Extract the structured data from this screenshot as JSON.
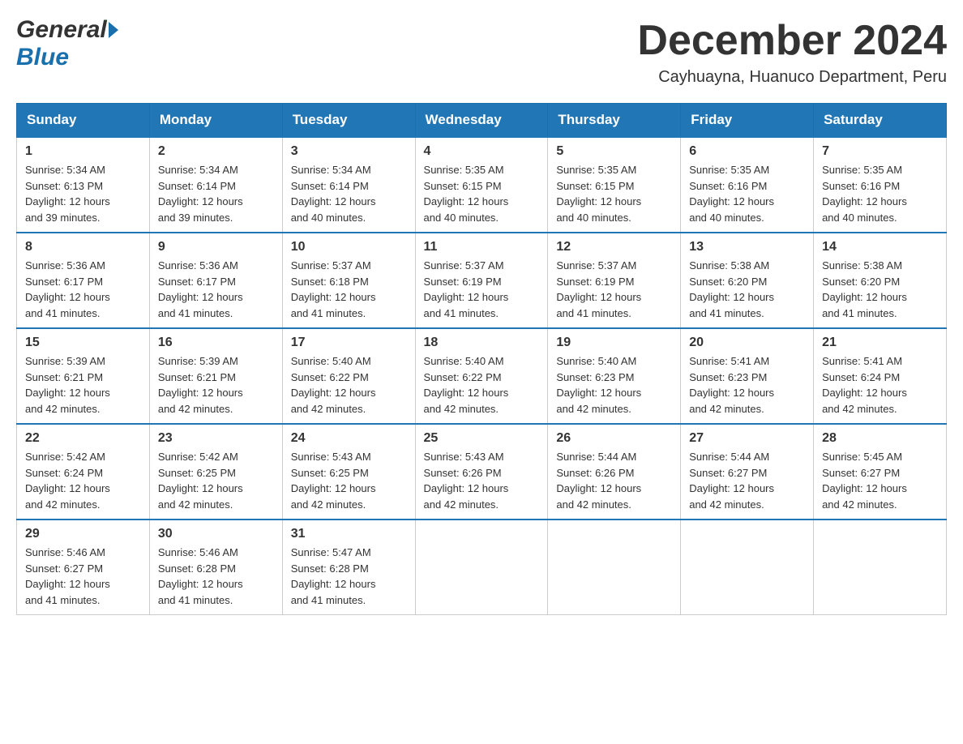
{
  "header": {
    "month_title": "December 2024",
    "location": "Cayhuayna, Huanuco Department, Peru"
  },
  "days_of_week": [
    "Sunday",
    "Monday",
    "Tuesday",
    "Wednesday",
    "Thursday",
    "Friday",
    "Saturday"
  ],
  "weeks": [
    [
      {
        "day": "1",
        "sunrise": "5:34 AM",
        "sunset": "6:13 PM",
        "daylight": "12 hours and 39 minutes."
      },
      {
        "day": "2",
        "sunrise": "5:34 AM",
        "sunset": "6:14 PM",
        "daylight": "12 hours and 39 minutes."
      },
      {
        "day": "3",
        "sunrise": "5:34 AM",
        "sunset": "6:14 PM",
        "daylight": "12 hours and 40 minutes."
      },
      {
        "day": "4",
        "sunrise": "5:35 AM",
        "sunset": "6:15 PM",
        "daylight": "12 hours and 40 minutes."
      },
      {
        "day": "5",
        "sunrise": "5:35 AM",
        "sunset": "6:15 PM",
        "daylight": "12 hours and 40 minutes."
      },
      {
        "day": "6",
        "sunrise": "5:35 AM",
        "sunset": "6:16 PM",
        "daylight": "12 hours and 40 minutes."
      },
      {
        "day": "7",
        "sunrise": "5:35 AM",
        "sunset": "6:16 PM",
        "daylight": "12 hours and 40 minutes."
      }
    ],
    [
      {
        "day": "8",
        "sunrise": "5:36 AM",
        "sunset": "6:17 PM",
        "daylight": "12 hours and 41 minutes."
      },
      {
        "day": "9",
        "sunrise": "5:36 AM",
        "sunset": "6:17 PM",
        "daylight": "12 hours and 41 minutes."
      },
      {
        "day": "10",
        "sunrise": "5:37 AM",
        "sunset": "6:18 PM",
        "daylight": "12 hours and 41 minutes."
      },
      {
        "day": "11",
        "sunrise": "5:37 AM",
        "sunset": "6:19 PM",
        "daylight": "12 hours and 41 minutes."
      },
      {
        "day": "12",
        "sunrise": "5:37 AM",
        "sunset": "6:19 PM",
        "daylight": "12 hours and 41 minutes."
      },
      {
        "day": "13",
        "sunrise": "5:38 AM",
        "sunset": "6:20 PM",
        "daylight": "12 hours and 41 minutes."
      },
      {
        "day": "14",
        "sunrise": "5:38 AM",
        "sunset": "6:20 PM",
        "daylight": "12 hours and 41 minutes."
      }
    ],
    [
      {
        "day": "15",
        "sunrise": "5:39 AM",
        "sunset": "6:21 PM",
        "daylight": "12 hours and 42 minutes."
      },
      {
        "day": "16",
        "sunrise": "5:39 AM",
        "sunset": "6:21 PM",
        "daylight": "12 hours and 42 minutes."
      },
      {
        "day": "17",
        "sunrise": "5:40 AM",
        "sunset": "6:22 PM",
        "daylight": "12 hours and 42 minutes."
      },
      {
        "day": "18",
        "sunrise": "5:40 AM",
        "sunset": "6:22 PM",
        "daylight": "12 hours and 42 minutes."
      },
      {
        "day": "19",
        "sunrise": "5:40 AM",
        "sunset": "6:23 PM",
        "daylight": "12 hours and 42 minutes."
      },
      {
        "day": "20",
        "sunrise": "5:41 AM",
        "sunset": "6:23 PM",
        "daylight": "12 hours and 42 minutes."
      },
      {
        "day": "21",
        "sunrise": "5:41 AM",
        "sunset": "6:24 PM",
        "daylight": "12 hours and 42 minutes."
      }
    ],
    [
      {
        "day": "22",
        "sunrise": "5:42 AM",
        "sunset": "6:24 PM",
        "daylight": "12 hours and 42 minutes."
      },
      {
        "day": "23",
        "sunrise": "5:42 AM",
        "sunset": "6:25 PM",
        "daylight": "12 hours and 42 minutes."
      },
      {
        "day": "24",
        "sunrise": "5:43 AM",
        "sunset": "6:25 PM",
        "daylight": "12 hours and 42 minutes."
      },
      {
        "day": "25",
        "sunrise": "5:43 AM",
        "sunset": "6:26 PM",
        "daylight": "12 hours and 42 minutes."
      },
      {
        "day": "26",
        "sunrise": "5:44 AM",
        "sunset": "6:26 PM",
        "daylight": "12 hours and 42 minutes."
      },
      {
        "day": "27",
        "sunrise": "5:44 AM",
        "sunset": "6:27 PM",
        "daylight": "12 hours and 42 minutes."
      },
      {
        "day": "28",
        "sunrise": "5:45 AM",
        "sunset": "6:27 PM",
        "daylight": "12 hours and 42 minutes."
      }
    ],
    [
      {
        "day": "29",
        "sunrise": "5:46 AM",
        "sunset": "6:27 PM",
        "daylight": "12 hours and 41 minutes."
      },
      {
        "day": "30",
        "sunrise": "5:46 AM",
        "sunset": "6:28 PM",
        "daylight": "12 hours and 41 minutes."
      },
      {
        "day": "31",
        "sunrise": "5:47 AM",
        "sunset": "6:28 PM",
        "daylight": "12 hours and 41 minutes."
      },
      null,
      null,
      null,
      null
    ]
  ],
  "labels": {
    "sunrise": "Sunrise:",
    "sunset": "Sunset:",
    "daylight": "Daylight:"
  },
  "colors": {
    "header_bg": "#2176b5",
    "border": "#2176b5"
  }
}
